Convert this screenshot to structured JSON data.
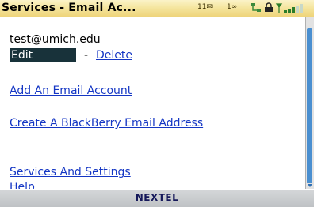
{
  "titlebar": {
    "title": "Services - Email Ac...",
    "mail_count": "11✉",
    "voicemail_count": "1∞",
    "icons": [
      "network-icon",
      "lock-icon",
      "signal-icon"
    ]
  },
  "content": {
    "account_email": "test@umich.edu",
    "edit_label": "Edit",
    "separator": "-",
    "delete_label": "Delete",
    "add_account_label": "Add An Email Account",
    "create_address_label": "Create A BlackBerry Email Address",
    "services_settings_label": "Services And Settings",
    "help_label": "Help"
  },
  "footer": {
    "carrier": "NEXTEL"
  },
  "colors": {
    "link": "#1436c4",
    "selection": "#18323a",
    "titlebar": "#f5e6a0",
    "scroll_thumb": "#4a8fd0"
  }
}
